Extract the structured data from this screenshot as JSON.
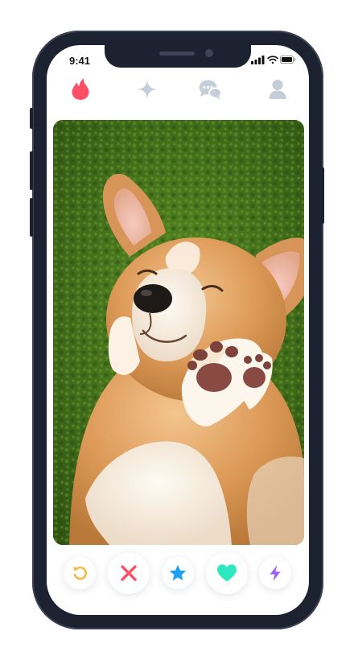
{
  "status_bar": {
    "time": "9:41",
    "icons": [
      "cellular-signal-icon",
      "wifi-icon",
      "battery-icon"
    ]
  },
  "top_nav": {
    "items": [
      {
        "icon": "flame-icon",
        "active": true,
        "color": "#fd5068"
      },
      {
        "icon": "sparkle-icon",
        "active": false,
        "color": "#c4cdd8"
      },
      {
        "icon": "chat-bubbles-icon",
        "active": false,
        "color": "#c4cdd8"
      },
      {
        "icon": "profile-icon",
        "active": false,
        "color": "#c4cdd8"
      }
    ]
  },
  "profile_card": {
    "photo": "corgi-puppy-on-grass"
  },
  "actions": [
    {
      "icon": "rewind-icon",
      "color": "#f5b748"
    },
    {
      "icon": "nope-x-icon",
      "color": "#fd5068"
    },
    {
      "icon": "super-like-star-icon",
      "color": "#1da1f2"
    },
    {
      "icon": "like-heart-icon",
      "color": "#2ee8c2"
    },
    {
      "icon": "boost-bolt-icon",
      "color": "#a45cf6"
    }
  ]
}
